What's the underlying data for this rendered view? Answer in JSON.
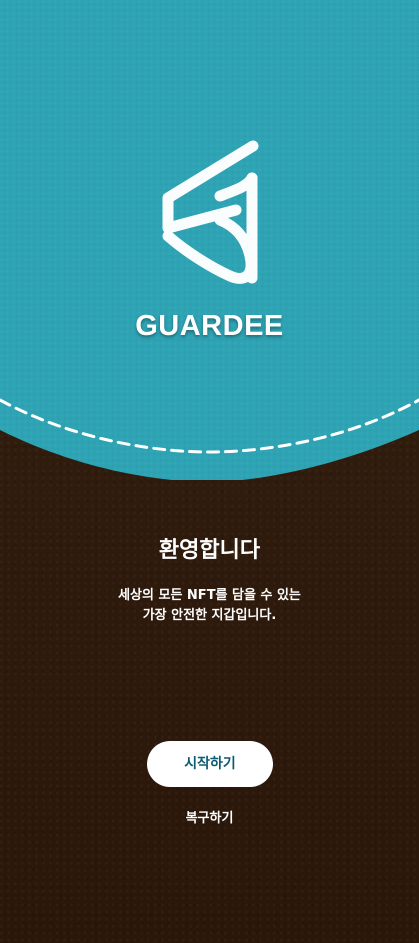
{
  "header": {
    "logo_icon": "guardee-logo-icon",
    "brand_name": "GUARDEE"
  },
  "welcome": {
    "title": "환영합니다",
    "description_lines": [
      "세상의 모든 NFT를 담을 수 있는",
      "가장 안전한 지갑입니다."
    ]
  },
  "actions": {
    "start_label": "시작하기",
    "restore_label": "복구하기"
  },
  "colors": {
    "top_panel": "#2ba2b3",
    "bottom_panel": "#341e0e",
    "stitch": "#ffffff",
    "start_button_text": "#0d5a74"
  }
}
